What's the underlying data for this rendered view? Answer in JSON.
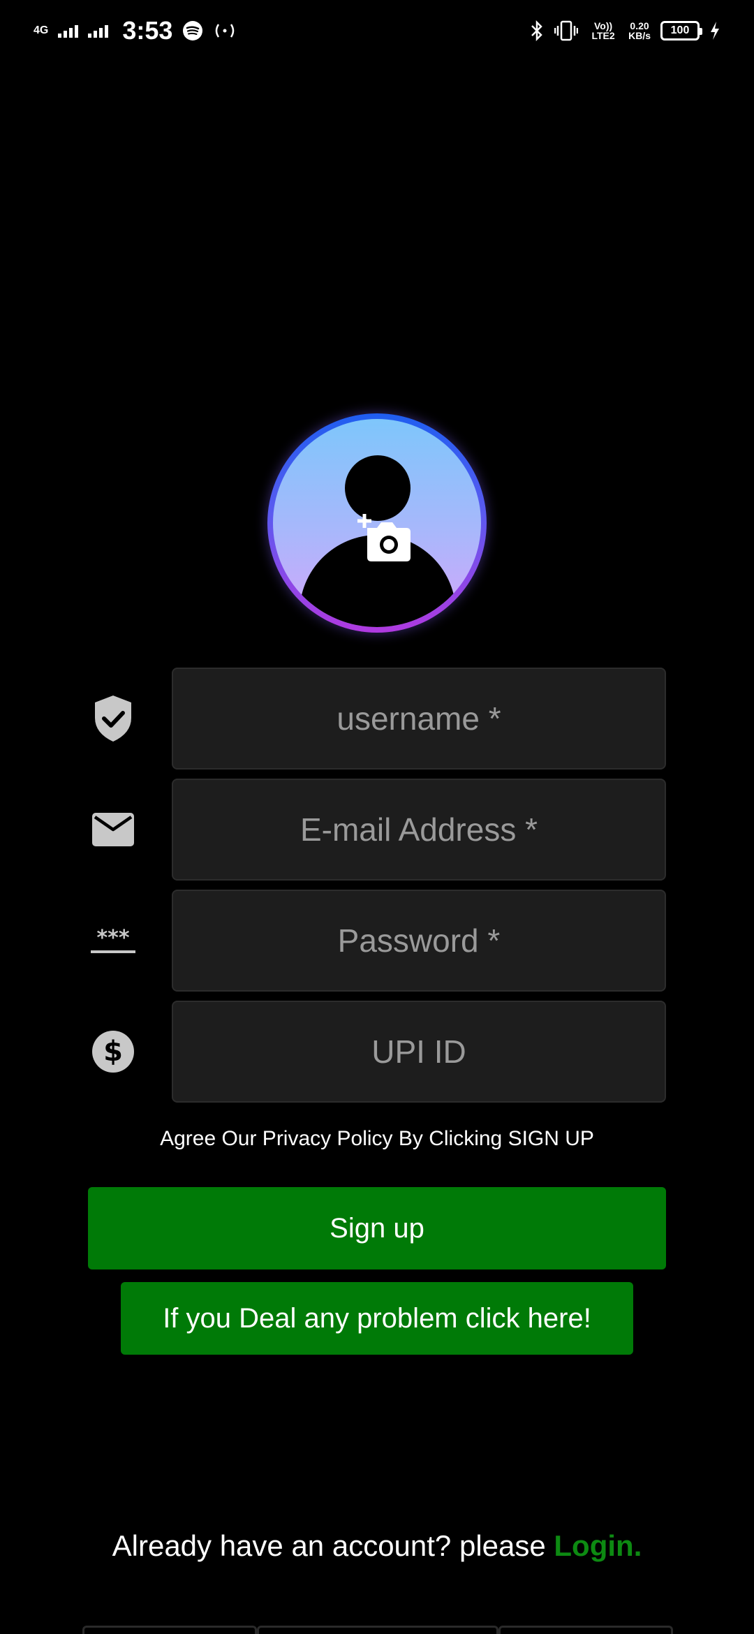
{
  "status_bar": {
    "network_type": "4G",
    "time": "3:53",
    "volte": "Vo)) LTE2",
    "speed_value": "0.20",
    "speed_unit": "KB/s",
    "battery": "100"
  },
  "avatar": {
    "add_photo_icon": "add-photo-icon"
  },
  "form": {
    "username": {
      "icon": "verified-shield-icon",
      "placeholder": "username *",
      "value": ""
    },
    "email": {
      "icon": "mail-icon",
      "placeholder": "E-mail Address *",
      "value": ""
    },
    "password": {
      "icon": "password-icon",
      "placeholder": "Password *",
      "value": ""
    },
    "upi": {
      "icon": "dollar-icon",
      "placeholder": "UPI ID",
      "value": ""
    }
  },
  "privacy_text": "Agree Our Privacy Policy By Clicking SIGN UP",
  "signup_label": "Sign up",
  "help_label": "If you Deal any problem click here!",
  "login_prompt": "Already have an account? please",
  "login_link": "Login.",
  "colors": {
    "background": "#000000",
    "field_bg": "#1d1d1d",
    "button_green": "#007a07",
    "link_green": "#0d8a12",
    "placeholder": "#9a9a9a"
  }
}
